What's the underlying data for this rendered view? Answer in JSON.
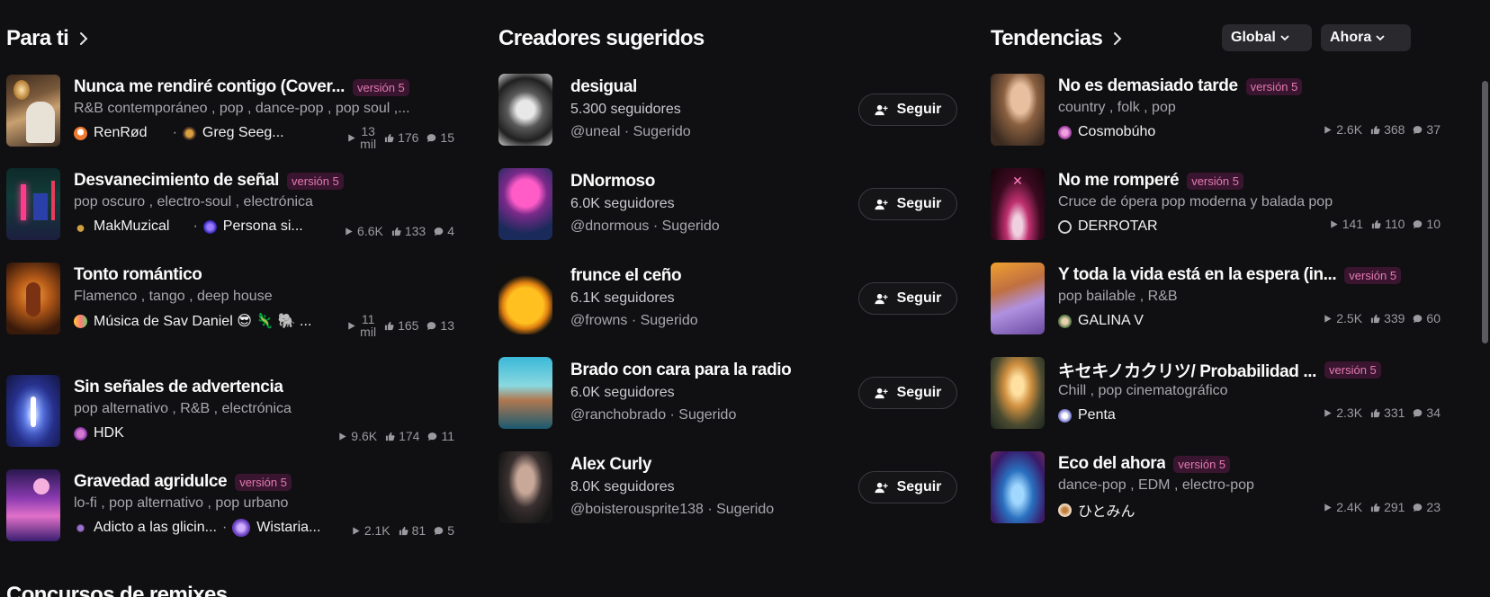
{
  "for_you": {
    "title": "Para ti",
    "songs": [
      {
        "title": "Nunca me rendiré contigo (Cover...",
        "badge": "versión 5",
        "genres": "R&B contemporáneo , pop , dance-pop , pop soul ,...",
        "artist": "RenRød",
        "artist2": "Greg Seeg...",
        "plays_top": "13",
        "plays_bottom": "mil",
        "likes": "176",
        "comments": "15"
      },
      {
        "title": "Desvanecimiento de señal",
        "badge": "versión 5",
        "genres": "pop oscuro , electro-soul , electrónica",
        "artist": "MakMuzical",
        "artist2": "Persona si...",
        "plays": "6.6K",
        "likes": "133",
        "comments": "4"
      },
      {
        "title": "Tonto romántico",
        "badge": "",
        "genres": "Flamenco , tango , deep house",
        "artist": "Música de Sav Daniel 😎 🦎 🐘 ...",
        "plays_top": "11",
        "plays_bottom": "mil",
        "likes": "165",
        "comments": "13"
      },
      {
        "title": "Sin señales de advertencia",
        "badge": "",
        "genres": "pop alternativo , R&B , electrónica",
        "artist": "HDK",
        "plays": "9.6K",
        "likes": "174",
        "comments": "11"
      },
      {
        "title": "Gravedad agridulce",
        "badge": "versión 5",
        "genres": "lo-fi , pop alternativo , pop urbano",
        "artist": "Adicto a las glicin...",
        "artist2": "Wistaria...",
        "plays": "2.1K",
        "likes": "81",
        "comments": "5"
      }
    ]
  },
  "creators": {
    "title": "Creadores sugeridos",
    "follow_label": "Seguir",
    "items": [
      {
        "name": "desigual",
        "followers": "5.300 seguidores",
        "handle": "@uneal · Sugerido"
      },
      {
        "name": "DNormoso",
        "followers": "6.0K seguidores",
        "handle": "@dnormous · Sugerido"
      },
      {
        "name": "frunce el ceño",
        "followers": "6.1K seguidores",
        "handle": "@frowns · Sugerido"
      },
      {
        "name": "Brado con cara para la radio",
        "followers": "6.0K seguidores",
        "handle": "@ranchobrado · Sugerido"
      },
      {
        "name": "Alex Curly",
        "followers": "8.0K seguidores",
        "handle": "@boisterousprite138 · Sugerido"
      }
    ]
  },
  "trending": {
    "title": "Tendencias",
    "filter_region": "Global",
    "filter_time": "Ahora",
    "songs": [
      {
        "title": "No es demasiado tarde",
        "badge": "versión 5",
        "genres": "country , folk , pop",
        "artist": "Cosmobúho",
        "plays": "2.6K",
        "likes": "368",
        "comments": "37"
      },
      {
        "title": "No me romperé",
        "badge": "versión 5",
        "genres": "Cruce de ópera pop moderna y balada pop",
        "artist": "DERROTAR",
        "plays": "141",
        "likes": "110",
        "comments": "10"
      },
      {
        "title": "Y toda la vida está en la espera (in...",
        "badge": "versión 5",
        "genres": "pop bailable , R&B",
        "artist": "GALINA V",
        "plays": "2.5K",
        "likes": "339",
        "comments": "60"
      },
      {
        "title": "キセキノカクリツ/ Probabilidad ...",
        "badge": "versión 5",
        "genres": "Chill , pop cinematográfico",
        "artist": "Penta",
        "plays": "2.3K",
        "likes": "331",
        "comments": "34"
      },
      {
        "title": "Eco del ahora",
        "badge": "versión 5",
        "genres": "dance-pop , EDM , electro-pop",
        "artist": "ひとみん",
        "plays": "2.4K",
        "likes": "291",
        "comments": "23"
      }
    ]
  },
  "remix": {
    "title": "Concursos de remixes"
  },
  "colors": {
    "background": "#101012",
    "badge_text": "#e37ab0",
    "badge_bg": "#3a1530",
    "muted": "#a7a7ad"
  },
  "icons": [
    "chevron-right-icon",
    "chevron-down-icon",
    "play-icon",
    "thumbs-up-icon",
    "comment-icon",
    "add-user-icon"
  ]
}
